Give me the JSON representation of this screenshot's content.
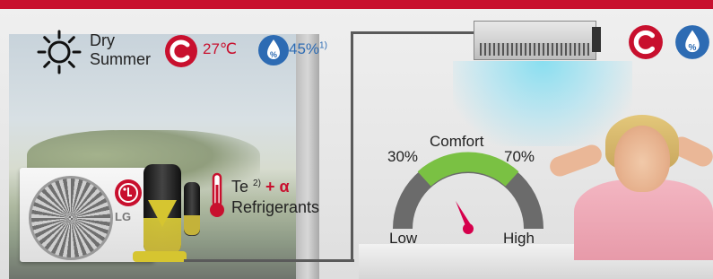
{
  "condition": {
    "weather_line1": "Dry",
    "weather_line2": "Summer",
    "temperature": "27℃",
    "humidity": "45%",
    "humidity_note": "1)"
  },
  "refrigerant": {
    "te_label": "Te",
    "te_note": "2)",
    "plus_label": "+ α",
    "refrigerants_label": "Refrigerants"
  },
  "outdoor_unit": {
    "brand": "LG"
  },
  "gauge": {
    "title": "Comfort",
    "lower_bound": "30%",
    "upper_bound": "70%",
    "low_label": "Low",
    "high_label": "High",
    "comfort_color": "#7ac143",
    "needle_color": "#d6004c"
  },
  "colors": {
    "accent_red": "#c8102e",
    "humidity_blue": "#2d6bb3"
  }
}
